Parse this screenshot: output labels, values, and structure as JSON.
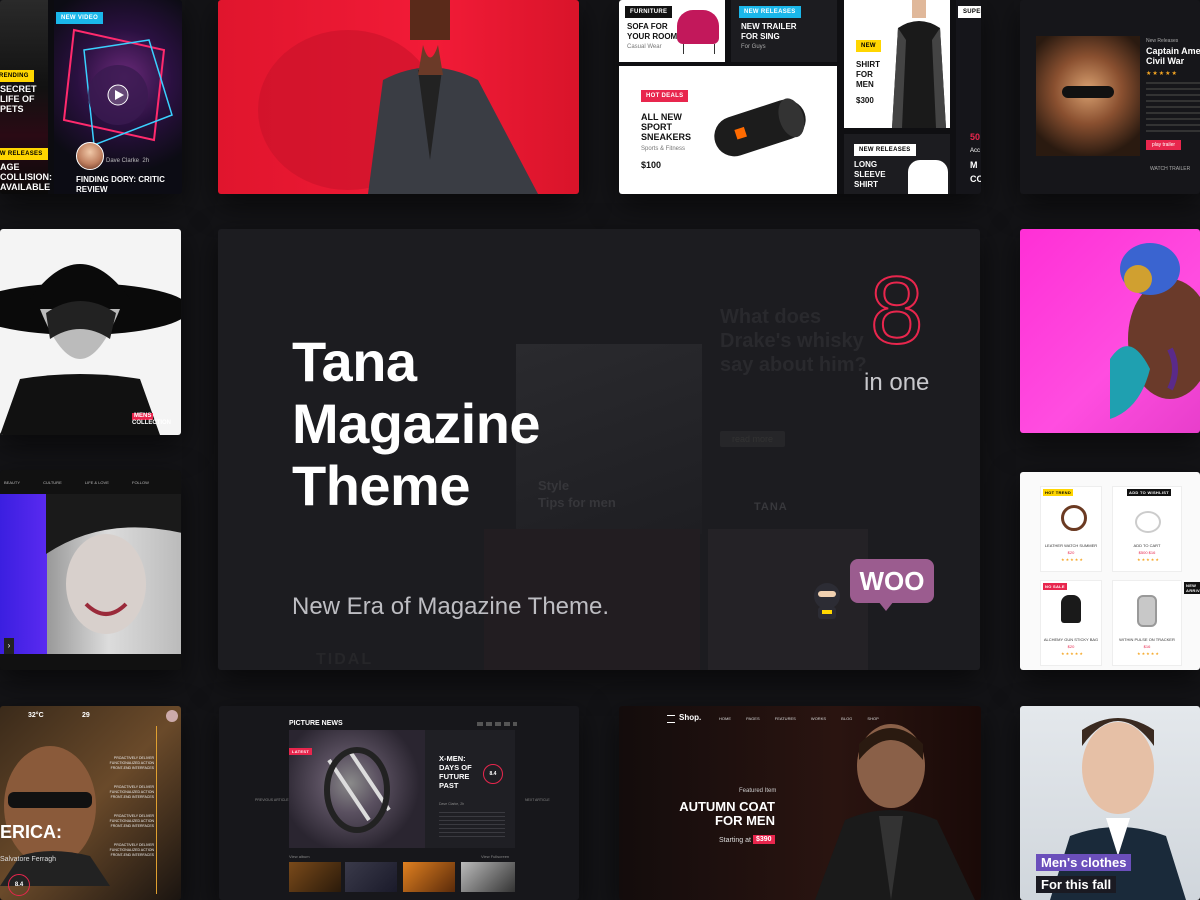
{
  "hero": {
    "title_lines": [
      "Tana",
      "Magazine",
      "Theme"
    ],
    "subtitle": "New Era of Magazine Theme.",
    "number": "8",
    "number_caption": "in one",
    "woo_badge": "WOO",
    "bg_headline": [
      "What does",
      "Drake's whisky",
      "say about him?"
    ],
    "bg_button": "read more",
    "bg_style_tag": "Style",
    "bg_style_text": "Tips for men",
    "bg_logo": "TANA",
    "bg_tidal": "TIDAL"
  },
  "tile_video": {
    "badge": "NEW VIDEO",
    "side_badge_top": "TRENDING",
    "side_text": [
      "SECRET",
      "LIFE OF",
      "PETS"
    ],
    "side_badge_bottom": "NEW RELEASES",
    "side_text2": [
      "AGE",
      "COLLISION:",
      "AVAILABLE"
    ],
    "author": "Dave Clarke",
    "time": "2h",
    "headline": "FINDING DORY: CRITIC REVIEW"
  },
  "tile_shop_grid": {
    "furniture_tag": "FURNITURE",
    "sofa_title": "SOFA FOR YOUR ROOM",
    "sofa_sub": "Casual Wear",
    "trailer_tag": "NEW RELEASES",
    "trailer_title": "NEW TRAILER FOR SING",
    "trailer_sub": "For Guys",
    "shirt_tag": "NEW",
    "shirt_title": "SHIRT FOR MEN",
    "shirt_price": "$300",
    "super_tag": "SUPER",
    "hot_tag": "HOT DEALS",
    "sneakers_title": "ALL NEW SPORT SNEAKERS",
    "sneakers_sub": "Sports & Fitness",
    "sneakers_price": "$100",
    "sleeve_tag": "NEW RELEASES",
    "sleeve_title": "LONG SLEEVE SHIRT",
    "side_partial": [
      "50",
      "Acc",
      "M",
      "CO"
    ]
  },
  "tile_movie": {
    "kicker": "New Releases",
    "title": "Captain America: Civil War",
    "play": "play trailer",
    "watch": "WATCH TRAILER"
  },
  "tile_mens": {
    "badge_top": "MENS",
    "badge_bottom": "COLLECTION"
  },
  "tile_fashion": {
    "nav": [
      "BEAUTY",
      "CULTURE",
      "LIFE & LOVE",
      "FOLLOW"
    ]
  },
  "tile_products": {
    "tag1": "HOT TREND",
    "tag2": "ADD TO WISHLIST",
    "tag3": "NO SALE",
    "tag4": "NEW ARRIVAL",
    "p1": "LEATHER WATCH SUMMER",
    "p1_price": "$20",
    "p2": "ADD TO CART",
    "p2_price": "$500 $16",
    "p3": "ALCHEMY GUN STICKY BAG",
    "p3_price": "$20",
    "p4": "WITHIN PULSE ON TRACKER",
    "p4_price": "$16"
  },
  "tile_weather": {
    "temp": "32°C",
    "date": "29",
    "headline": "ERICA:",
    "author": "Salvatore Ferragh",
    "score": "8.4",
    "items": [
      "PROACTIVELY DELIVER FUNCTIONALIZED ACTION FRONT-END INTERFACES",
      "PROACTIVELY DELIVER FUNCTIONALIZED ACTION FRONT-END INTERFACES",
      "PROACTIVELY DELIVER FUNCTIONALIZED ACTION FRONT-END INTERFACES",
      "PROACTIVELY DELIVER FUNCTIONALIZED ACTION FRONT-END INTERFACES"
    ]
  },
  "tile_picture_news": {
    "header": "PICTURE NEWS",
    "latest": "LATEST",
    "headline": "X-MEN: DAYS OF FUTURE PAST",
    "author": "Dave Clarke, 2h",
    "score": "8.4",
    "prev": "PREVIOUS ARTICLE",
    "next": "NEXT ARTICLE",
    "view_album": "View album",
    "view_fullscreen": "View Fullscreen"
  },
  "tile_shop_hero": {
    "logo": "Shop.",
    "nav": [
      "HOME",
      "PAGES",
      "FEATURES",
      "WORKS",
      "BLOG",
      "SHOP"
    ],
    "featured": "Featured Item",
    "title_lines": [
      "AUTUMN COAT",
      "FOR MEN"
    ],
    "starting": "Starting at",
    "price": "$390"
  },
  "tile_clothes": {
    "line1": "Men's clothes",
    "line2": "For this fall"
  },
  "colors": {
    "accent_red": "#e8264d",
    "accent_yellow": "#ffd600",
    "accent_cyan": "#1ab7ea",
    "woo_purple": "#9b5c8f",
    "bg": "#141417",
    "hero_bg": "#1c1c20"
  }
}
